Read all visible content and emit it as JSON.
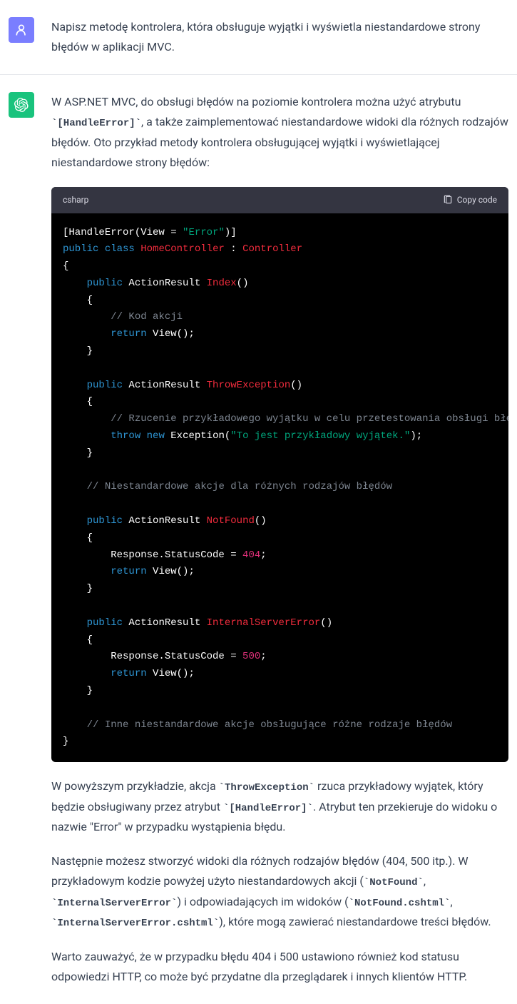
{
  "user": {
    "text": "Napisz metodę kontrolera, która obsługuje wyjątki i wyświetla niestandardowe strony błędów w aplikacji MVC."
  },
  "assistant": {
    "intro_p1_a": "W ASP.NET MVC, do obsługi błędów na poziomie kontrolera można użyć atrybutu ",
    "intro_code1": "`[HandleError]`",
    "intro_p1_b": ", a także zaimplementować niestandardowe widoki dla różnych rodzajów błędów. Oto przykład metody kontrolera obsługującej wyjątki i wyświetlającej niestandardowe strony błędów:",
    "code_lang": "csharp",
    "copy_label": "Copy code",
    "code": {
      "l1_a": "[",
      "l1_b": "HandleError(View = ",
      "l1_c": "\"Error\"",
      "l1_d": ")",
      "l1_e": "]",
      "l2_a": "public",
      "l2_b": " ",
      "l2_c": "class",
      "l2_d": " ",
      "l2_e": "HomeController",
      "l2_f": " : ",
      "l2_g": "Controller",
      "l3": "{",
      "l4_a": "    ",
      "l4_b": "public",
      "l4_c": " ActionResult ",
      "l4_d": "Index",
      "l4_e": "()",
      "l5": "    {",
      "l6_a": "        ",
      "l6_b": "// Kod akcji",
      "l7_a": "        ",
      "l7_b": "return",
      "l7_c": " View();",
      "l8": "    }",
      "l9": "",
      "l10_a": "    ",
      "l10_b": "public",
      "l10_c": " ActionResult ",
      "l10_d": "ThrowException",
      "l10_e": "()",
      "l11": "    {",
      "l12_a": "        ",
      "l12_b": "// Rzucenie przykładowego wyjątku w celu przetestowania obsługi błędów",
      "l13_a": "        ",
      "l13_b": "throw",
      "l13_c": " ",
      "l13_d": "new",
      "l13_e": " Exception(",
      "l13_f": "\"To jest przykładowy wyjątek.\"",
      "l13_g": ");",
      "l14": "    }",
      "l15": "",
      "l16_a": "    ",
      "l16_b": "// Niestandardowe akcje dla różnych rodzajów błędów",
      "l17": "",
      "l18_a": "    ",
      "l18_b": "public",
      "l18_c": " ActionResult ",
      "l18_d": "NotFound",
      "l18_e": "()",
      "l19": "    {",
      "l20_a": "        Response.StatusCode = ",
      "l20_b": "404",
      "l20_c": ";",
      "l21_a": "        ",
      "l21_b": "return",
      "l21_c": " View();",
      "l22": "    }",
      "l23": "",
      "l24_a": "    ",
      "l24_b": "public",
      "l24_c": " ActionResult ",
      "l24_d": "InternalServerError",
      "l24_e": "()",
      "l25": "    {",
      "l26_a": "        Response.StatusCode = ",
      "l26_b": "500",
      "l26_c": ";",
      "l27_a": "        ",
      "l27_b": "return",
      "l27_c": " View();",
      "l28": "    }",
      "l29": "",
      "l30_a": "    ",
      "l30_b": "// Inne niestandardowe akcje obsługujące różne rodzaje błędów",
      "l31": "}"
    },
    "p2_a": "W powyższym przykładzie, akcja ",
    "p2_code1": "`ThrowException`",
    "p2_b": " rzuca przykładowy wyjątek, który będzie obsługiwany przez atrybut ",
    "p2_code2": "`[HandleError]`",
    "p2_c": ". Atrybut ten przekieruje do widoku o nazwie \"Error\" w przypadku wystąpienia błędu.",
    "p3_a": "Następnie możesz stworzyć widoki dla różnych rodzajów błędów (404, 500 itp.). W przykładowym kodzie powyżej użyto niestandardowych akcji (",
    "p3_code1": "`NotFound`",
    "p3_b": ", ",
    "p3_code2": "`InternalServerError`",
    "p3_c": ") i odpowiadających im widoków (",
    "p3_code3": "`NotFound.cshtml`",
    "p3_d": ", ",
    "p3_code4": "`InternalServerError.cshtml`",
    "p3_e": "), które mogą zawierać niestandardowe treści błędów.",
    "p4": "Warto zauważyć, że w przypadku błędu 404 i 500 ustawiono również kod statusu odpowiedzi HTTP, co może być przydatne dla przeglądarek i innych klientów HTTP."
  }
}
